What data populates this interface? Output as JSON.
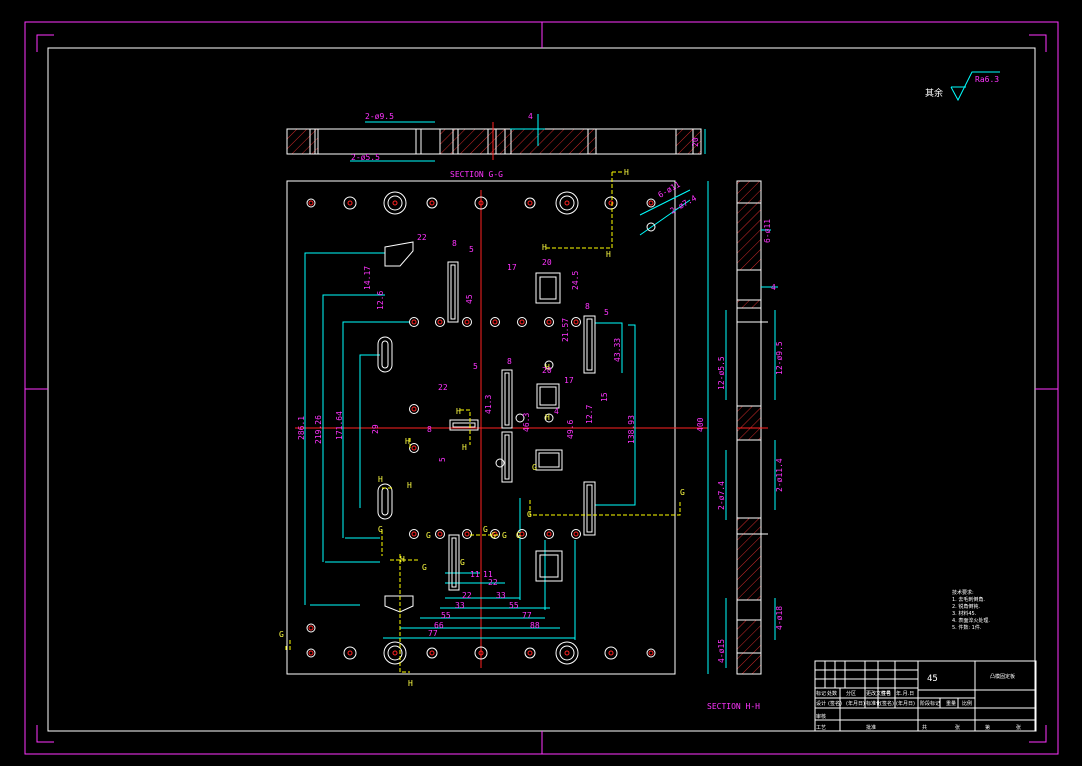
{
  "colors": {
    "background": "#000000",
    "frame": "#ff33ff",
    "part": "#ffffff",
    "dimension": "#00ffff",
    "text": "#ff33ff",
    "centerline": "#ff2222",
    "hidden": "#ffff00",
    "hatch": "#ff3333"
  },
  "labels": {
    "roughness_prefix": "其余",
    "roughness_value": "Ra6.3",
    "section_g": "SECTION G-G",
    "section_h": "SECTION H-H",
    "cut_g": "G",
    "cut_h": "H"
  },
  "top_view_dims": {
    "hole_a": "2-ø9.5",
    "hole_b": "2-ø5.5",
    "depth": "4",
    "thickness": "20"
  },
  "side_view_dims": {
    "d1": "6-ø11",
    "d2": "4",
    "d3": "12-ø5.5",
    "d4": "12-ø9.5",
    "d5": "2-ø7.4",
    "d6": "2-ø11.4",
    "d7": "4-ø15",
    "d8": "4-ø18"
  },
  "main_view_dims": {
    "overall_height": "400",
    "d286": "286.1",
    "d219": "219.26",
    "d171": "171.64",
    "d29": "29",
    "d138": "138.93",
    "d43": "43.33",
    "d21": "21.57",
    "d49": "49.6",
    "d46": "46.3",
    "d15": "15",
    "d12": "12.7",
    "d24": "24.5",
    "d20": "20",
    "d17": "17",
    "d8a": "8",
    "d5a": "5",
    "d22": "22",
    "d45": "45",
    "d12b": "12.6",
    "d14": "14.17",
    "b11a": "11",
    "b11b": "11",
    "b22": "22",
    "b22b": "22",
    "b33": "33",
    "b33b": "33",
    "b55": "55",
    "b55b": "55",
    "b66": "66",
    "b77": "77",
    "b77b": "77",
    "b88": "88",
    "d8b": "8",
    "d5b": "5",
    "d8c": "8",
    "d20b": "20",
    "d41": "41.3",
    "d17b": "17",
    "d22b": "22",
    "d4c": "4",
    "d8d": "8"
  },
  "notes": {
    "title": "技术要求:",
    "items": [
      "1. 去毛刺倒角.",
      "2. 锐角倒钝.",
      "3. 材料45.",
      "4. 表面淬火处理.",
      "5. 件数: 1件."
    ]
  },
  "title_block": {
    "material": "45",
    "part_name": "凸模固定板",
    "row1": [
      "标记",
      "处数",
      "分区",
      "更改文件号",
      "签名",
      "年.月.日"
    ],
    "row2": [
      "设计",
      "(签名)",
      "(年月日)",
      "标准化",
      "(签名)",
      "(年月日)"
    ],
    "row3": [
      "审核"
    ],
    "row4": [
      "工艺",
      "批准"
    ],
    "stage": [
      "阶段标记",
      "重量",
      "比例"
    ],
    "sheet": [
      "共",
      "张",
      "第",
      "张"
    ]
  }
}
